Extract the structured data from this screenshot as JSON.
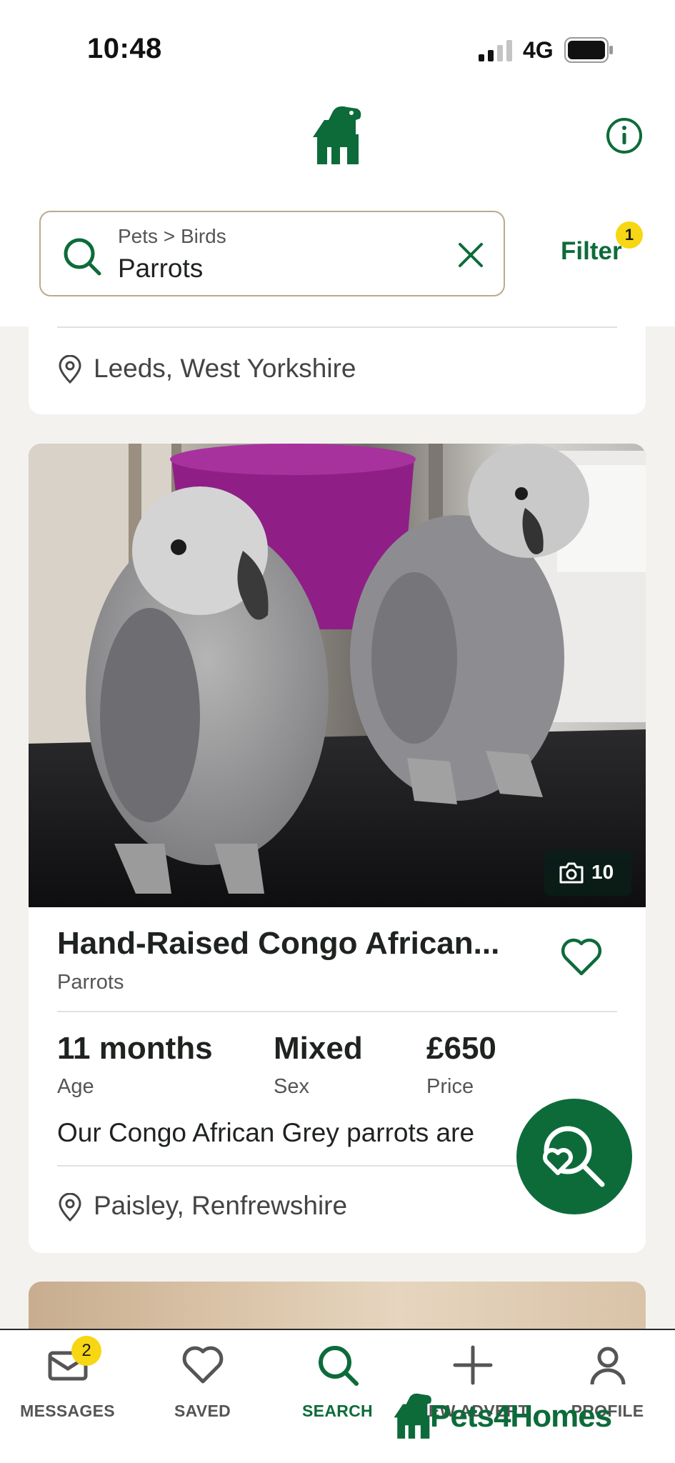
{
  "status_bar": {
    "time": "10:48",
    "network": "4G"
  },
  "header": {
    "logo_icon": "pets4homes-logo-icon",
    "info_icon": "info-icon"
  },
  "search": {
    "breadcrumb": "Pets > Birds",
    "value": "Parrots",
    "clear_icon": "close-icon"
  },
  "filter": {
    "label": "Filter",
    "badge": "1"
  },
  "previous_listing": {
    "location": "Leeds, West Yorkshire"
  },
  "listing": {
    "photo_count": "10",
    "title": "Hand-Raised Congo African...",
    "category": "Parrots",
    "stats": [
      {
        "value": "11 months",
        "label": "Age"
      },
      {
        "value": "Mixed",
        "label": "Sex"
      },
      {
        "value": "£650",
        "label": "Price"
      }
    ],
    "description": "Our Congo African Grey parrots are",
    "location": "Paisley, Renfrewshire"
  },
  "fab": {
    "icon": "saved-search-icon"
  },
  "bottom_nav": {
    "items": [
      {
        "label": "MESSAGES",
        "icon": "envelope-icon",
        "badge": "2"
      },
      {
        "label": "SAVED",
        "icon": "heart-icon"
      },
      {
        "label": "SEARCH",
        "icon": "search-icon",
        "active": true
      },
      {
        "label": "NEW ADVERT",
        "icon": "plus-icon"
      },
      {
        "label": "PROFILE",
        "icon": "person-icon"
      }
    ]
  },
  "watermark": "Pets4Homes",
  "colors": {
    "brand_green": "#0d6b3a",
    "badge_yellow": "#f7d614",
    "background": "#f3f2ef"
  }
}
